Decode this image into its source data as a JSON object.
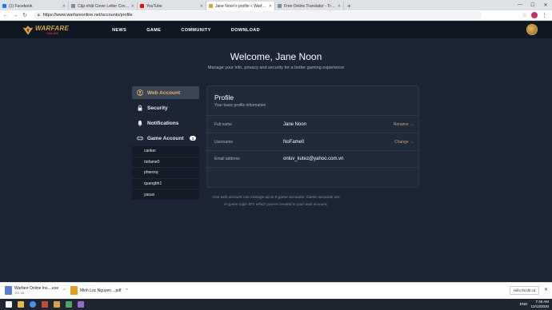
{
  "browser": {
    "tabs": [
      {
        "label": "(1) Facebook",
        "color": "#1877f2"
      },
      {
        "label": "Cập nhật Cover Letter Cover lett",
        "color": "#7a8ea8"
      },
      {
        "label": "YouTube",
        "color": "#ff0000"
      },
      {
        "label": "Jane Noon's profile « Warface O",
        "color": "#d9a441"
      },
      {
        "label": "Free Online Translator - Transla",
        "color": "#7a8ea8"
      }
    ],
    "new_tab": "+",
    "url": "https://www.warfareonline.net/accounts/profile"
  },
  "site": {
    "logo_main": "WARFARE",
    "logo_sub": "ONLINE",
    "nav": [
      "NEWS",
      "GAME",
      "COMMUNITY",
      "DOWNLOAD"
    ]
  },
  "page": {
    "welcome": "Welcome, Jane Noon",
    "subtitle": "Manage your info, privacy and security for a better gaming experience",
    "sidebar": {
      "web_account": "Web Account",
      "security": "Security",
      "notifications": "Notifications",
      "game_account": "Game Account",
      "game_account_count": "1",
      "accounts": [
        "canker",
        "nofame0",
        "phienxq",
        "quangbh1",
        "yasuo"
      ]
    },
    "profile": {
      "title": "Profile",
      "subtitle": "Your basic profile information",
      "rows": [
        {
          "label": "Full name",
          "value": "Jane Noon",
          "action": "Rename →"
        },
        {
          "label": "Username",
          "value": "NoFame0",
          "action": "Change →"
        },
        {
          "label": "Email address",
          "value": "onluv_kutez@yahoo.com.vn",
          "action": ""
        }
      ]
    },
    "note_line1": "One web account can manage up to 5 game accounts. Game accounts are",
    "note_line2": "in-game login ID's which you've created in your web account."
  },
  "downloads": {
    "items": [
      {
        "name": "Warfare Online Ins....exe",
        "size": "151 kB",
        "color": "#5b7bd5"
      },
      {
        "name": "Minh Loc Nguyen....pdf",
        "size": "",
        "color": "#e0a020"
      }
    ],
    "show_all": "Hiển thị tất cả"
  },
  "taskbar": {
    "lang": "ENG",
    "time": "7:46 AM",
    "date": "12/13/2020"
  }
}
